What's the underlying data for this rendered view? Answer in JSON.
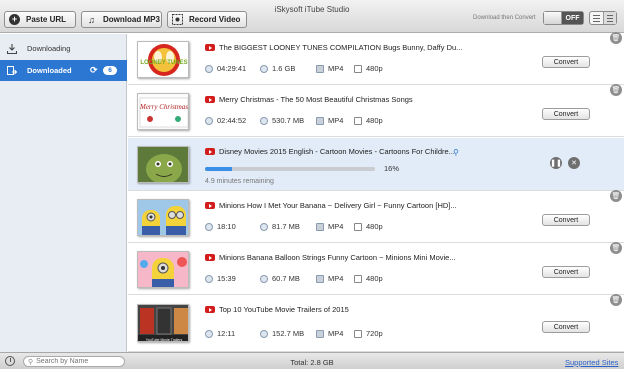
{
  "app": {
    "title": "iSkysoft iTube Studio"
  },
  "toolbar": {
    "paste_url": "Paste URL",
    "download_mp3": "Download MP3",
    "record_video": "Record Video",
    "convert_label": "Download then Convert",
    "toggle_state": "OFF"
  },
  "sidebar": {
    "items": [
      {
        "label": "Downloading",
        "icon": "download-icon"
      },
      {
        "label": "Downloaded",
        "icon": "downloaded-list-icon",
        "count": "6"
      }
    ]
  },
  "list": {
    "rows": [
      {
        "title": "The BIGGEST LOONEY TUNES COMPILATION  Bugs Bunny, Daffy Du...",
        "duration": "04:29:41",
        "size": "1.6 GB",
        "format": "MP4",
        "resolution": "480p",
        "action": "Convert",
        "thumb_text": "LOONEY TUNES"
      },
      {
        "title": "Merry Christmas - The 50 Most Beautiful Christmas Songs",
        "duration": "02:44:52",
        "size": "530.7 MB",
        "format": "MP4",
        "resolution": "480p",
        "action": "Convert",
        "thumb_text": "Merry Christmas"
      },
      {
        "title": "Disney Movies 2015 English - Cartoon Movies - Cartoons For Childre...",
        "progress": 0.16,
        "percent": "16%",
        "remaining": "4.9 minutes remaining"
      },
      {
        "title": "Minions How I Met Your Banana ~ Delivery Girl ~ Funny Cartoon [HD]...",
        "duration": "18:10",
        "size": "81.7 MB",
        "format": "MP4",
        "resolution": "480p",
        "action": "Convert"
      },
      {
        "title": "Minions Banana Balloon Strings Funny Cartoon ~ Minions Mini Movie...",
        "duration": "15:39",
        "size": "60.7 MB",
        "format": "MP4",
        "resolution": "480p",
        "action": "Convert"
      },
      {
        "title": "Top 10 YouTube Movie Trailers of 2015",
        "duration": "12:11",
        "size": "152.7 MB",
        "format": "MP4",
        "resolution": "720p",
        "action": "Convert",
        "thumb_text": "YouTube Movie Trailers"
      }
    ]
  },
  "footer": {
    "search_placeholder": "Search by Name",
    "total": "Total: 2.8 GB",
    "supported_sites": "Supported Sites"
  },
  "colors": {
    "accent": "#2b77d2",
    "youtube": "#d31d1d",
    "progress": "#3b8ee6"
  }
}
